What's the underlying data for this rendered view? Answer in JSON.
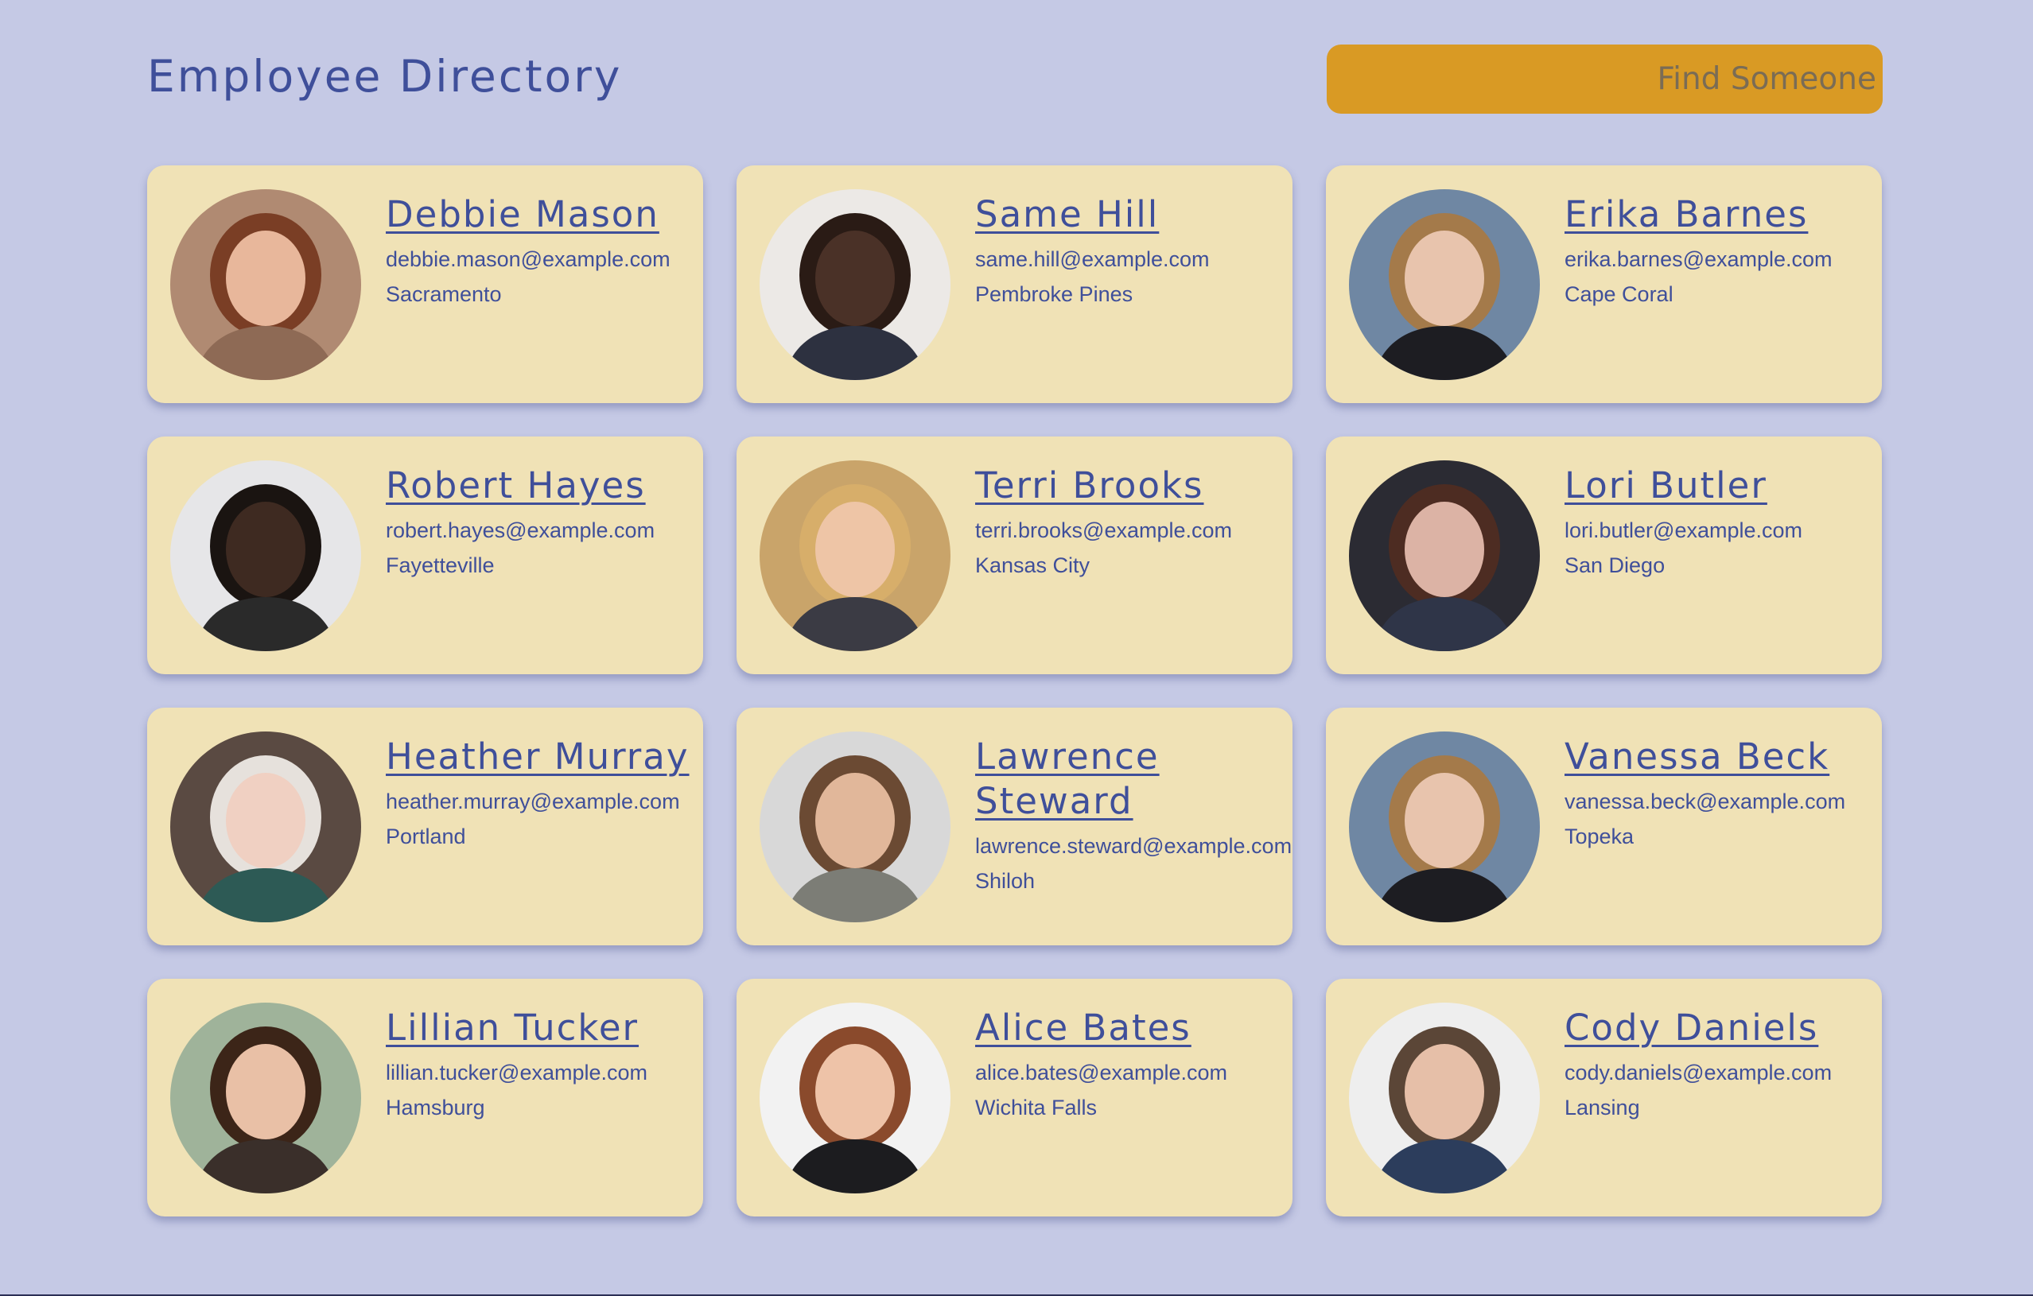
{
  "header": {
    "title": "Employee Directory",
    "search_placeholder": "Find Someone"
  },
  "colors": {
    "background": "#c5c9e5",
    "card": "#f0e2b6",
    "accent": "#d99a24",
    "text": "#3f4f9a"
  },
  "employees": [
    {
      "name": "Debbie Mason",
      "email": "debbie.mason@example.com",
      "city": "Sacramento",
      "avatar": {
        "bg": "#b08a72",
        "skin": "#e8b79b",
        "hair": "#7a3e25",
        "shirt": "#8e6a55"
      }
    },
    {
      "name": "Same Hill",
      "email": "same.hill@example.com",
      "city": "Pembroke Pines",
      "avatar": {
        "bg": "#ece9e6",
        "skin": "#4a3127",
        "hair": "#2a1b15",
        "shirt": "#2d3140"
      }
    },
    {
      "name": "Erika Barnes",
      "email": "erika.barnes@example.com",
      "city": "Cape Coral",
      "avatar": {
        "bg": "#6f87a3",
        "skin": "#e8c4ad",
        "hair": "#a47a4a",
        "shirt": "#1d1d22"
      }
    },
    {
      "name": "Robert Hayes",
      "email": "robert.hayes@example.com",
      "city": "Fayetteville",
      "avatar": {
        "bg": "#e6e6e8",
        "skin": "#3e2a21",
        "hair": "#1a1411",
        "shirt": "#2a2a2a"
      }
    },
    {
      "name": "Terri Brooks",
      "email": "terri.brooks@example.com",
      "city": "Kansas City",
      "avatar": {
        "bg": "#c9a46a",
        "skin": "#eec5a6",
        "hair": "#d7ae6a",
        "shirt": "#3b3b44"
      }
    },
    {
      "name": "Lori Butler",
      "email": "lori.butler@example.com",
      "city": "San Diego",
      "avatar": {
        "bg": "#2b2b33",
        "skin": "#dcb3a5",
        "hair": "#4d2c22",
        "shirt": "#2f3548"
      }
    },
    {
      "name": "Heather Murray",
      "email": "heather.murray@example.com",
      "city": "Portland",
      "avatar": {
        "bg": "#5a4a42",
        "skin": "#f0d0c2",
        "hair": "#e6e1dc",
        "shirt": "#2d5a55"
      }
    },
    {
      "name": "Lawrence Steward",
      "email": "lawrence.steward@example.com",
      "city": "Shiloh",
      "avatar": {
        "bg": "#d8d8d8",
        "skin": "#e1b79a",
        "hair": "#6b4a33",
        "shirt": "#7c7d76"
      }
    },
    {
      "name": "Vanessa Beck",
      "email": "vanessa.beck@example.com",
      "city": "Topeka",
      "avatar": {
        "bg": "#6f87a3",
        "skin": "#e8c4ad",
        "hair": "#a47a4a",
        "shirt": "#1d1d22"
      }
    },
    {
      "name": "Lillian Tucker",
      "email": "lillian.tucker@example.com",
      "city": "Hamsburg",
      "avatar": {
        "bg": "#9fb39a",
        "skin": "#e9c0a6",
        "hair": "#3c2518",
        "shirt": "#3a2f2a"
      }
    },
    {
      "name": "Alice Bates",
      "email": "alice.bates@example.com",
      "city": "Wichita Falls",
      "avatar": {
        "bg": "#f2f2f2",
        "skin": "#eec3a8",
        "hair": "#8a4a2c",
        "shirt": "#1c1c1f"
      }
    },
    {
      "name": "Cody Daniels",
      "email": "cody.daniels@example.com",
      "city": "Lansing",
      "avatar": {
        "bg": "#eeeeee",
        "skin": "#e6bfa8",
        "hair": "#5b4637",
        "shirt": "#2c3d5c"
      }
    }
  ]
}
